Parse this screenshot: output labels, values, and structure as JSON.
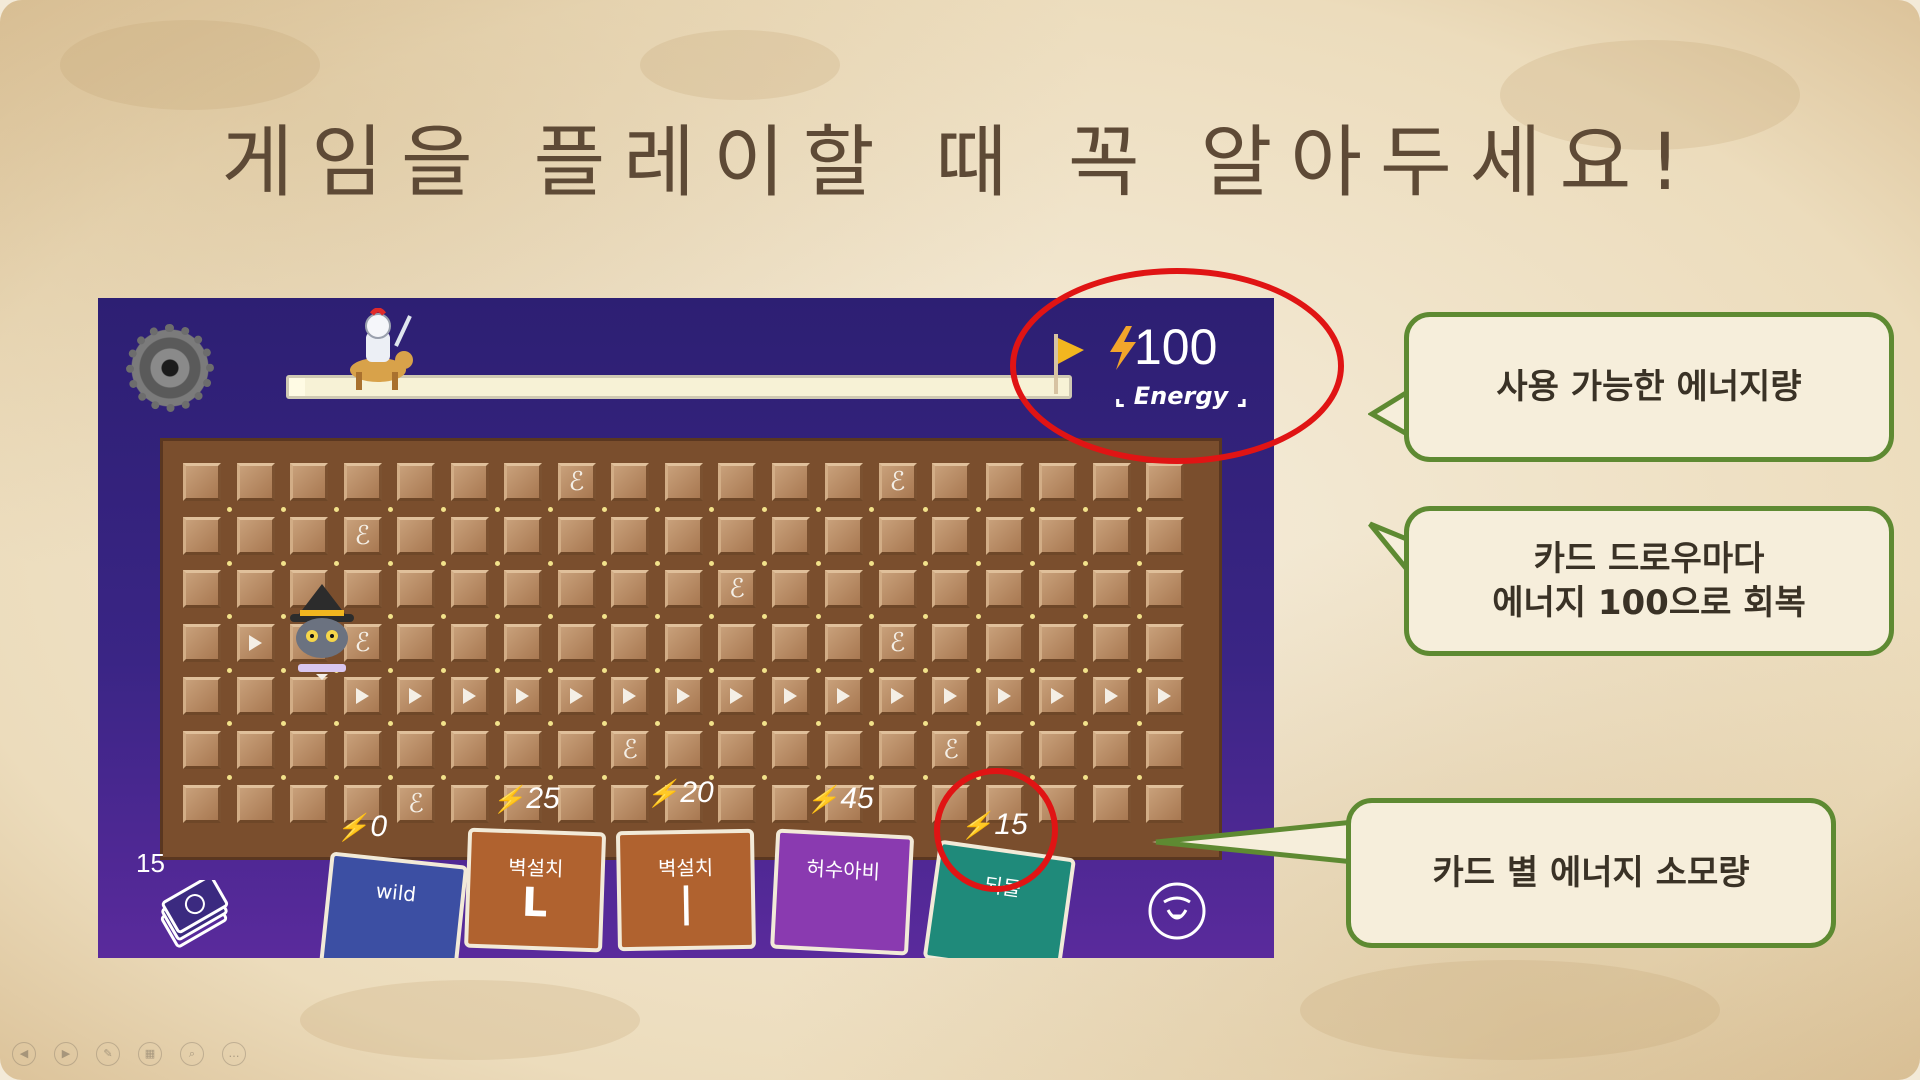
{
  "title": "게임을 플레이할 때 꼭 알아두세요!",
  "game": {
    "energy": {
      "value": "100",
      "label": "Energy"
    },
    "progress": 0.02,
    "deck_count": "15",
    "cards": [
      {
        "name": "wild",
        "cost": "0",
        "color": "#3c4fa3"
      },
      {
        "name": "벽설치",
        "glyph": "L",
        "cost": "25",
        "color": "#b0622f"
      },
      {
        "name": "벽설치",
        "glyph": "|",
        "cost": "20",
        "color": "#b0622f"
      },
      {
        "name": "허수아비",
        "cost": "45",
        "color": "#8a3ab0"
      },
      {
        "name": "되돌",
        "cost": "15",
        "color": "#1f8a7a"
      }
    ],
    "icons": {
      "settings": "gear-icon",
      "goal": "flag-icon",
      "energy": "lightning-icon",
      "deck": "card-deck-icon",
      "discard": "cat-rune-icon"
    }
  },
  "callouts": {
    "energy_available": "사용 가능한 에너지량",
    "energy_recovery_line1": "카드 드로우마다",
    "energy_recovery_line2": "에너지 100으로 회복",
    "card_cost": "카드 별 에너지 소모량"
  },
  "colors": {
    "highlight": "#e01414",
    "callout_border": "#5e8a32",
    "game_bg": "#2d1f73"
  }
}
